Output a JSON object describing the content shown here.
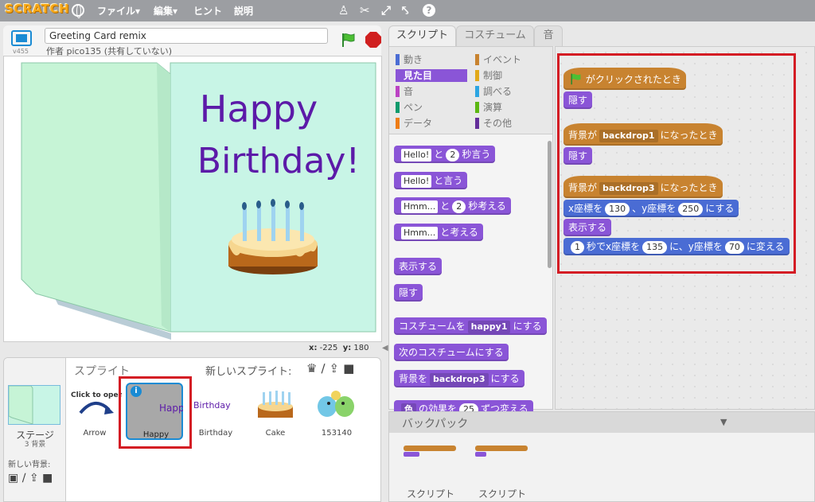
{
  "menubar": {
    "logo": "SCRATCH",
    "file": "ファイル▾",
    "edit": "編集▾",
    "tips": "ヒント",
    "about": "説明"
  },
  "stage_header": {
    "version": "v455",
    "title": "Greeting Card remix",
    "author": "作者 pico135 (共有していない)"
  },
  "stage": {
    "card_line1": "Happy",
    "card_line2": "Birthday!",
    "coord_x_label": "x:",
    "coord_x": "-225",
    "coord_y_label": "y:",
    "coord_y": "180"
  },
  "sprite_pane": {
    "sprites_label": "スプライト",
    "new_sprite_label": "新しいスプライト:",
    "stage_label": "ステージ",
    "stage_sub": "3 背景",
    "new_backdrop_label": "新しい背景:",
    "sprites": [
      {
        "name": "Arrow",
        "thumb_text": "Click to open"
      },
      {
        "name": "Happy",
        "thumb_text": "Happy"
      },
      {
        "name": "Birthday",
        "thumb_text": "Birthday"
      },
      {
        "name": "Cake"
      },
      {
        "name": "153140"
      }
    ],
    "info_badge": "i"
  },
  "tabs": {
    "scripts": "スクリプト",
    "costumes": "コスチューム",
    "sounds": "音"
  },
  "categories": {
    "motion": "動き",
    "looks": "見た目",
    "sound": "音",
    "pen": "ペン",
    "data": "データ",
    "events": "イベント",
    "control": "制御",
    "sensing": "調べる",
    "operators": "演算",
    "more": "その他"
  },
  "palette_blocks": {
    "say_for_text": "Hello!",
    "say_for_mid": "と",
    "say_for_num": "2",
    "say_for_end": "秒言う",
    "say_text": "Hello!",
    "say_end": "と言う",
    "think_for_text": "Hmm...",
    "think_for_mid": "と",
    "think_for_num": "2",
    "think_for_end": "秒考える",
    "think_text": "Hmm...",
    "think_end": "と考える",
    "show": "表示する",
    "hide": "隠す",
    "switch_costume_start": "コスチュームを",
    "switch_costume_value": "happy1",
    "switch_costume_end": "にする",
    "next_costume": "次のコスチュームにする",
    "switch_backdrop_start": "背景を",
    "switch_backdrop_value": "backdrop3",
    "switch_backdrop_end": "にする",
    "partial_start": "色",
    "partial_mid": "の効果を",
    "partial_num": "25",
    "partial_end": "ずつ変える"
  },
  "script_blocks": {
    "flag_hat": "がクリックされたとき",
    "hide1": "隠す",
    "backdrop_hat1_start": "背景が",
    "backdrop_hat1_value": "backdrop1",
    "backdrop_hat1_end": "になったとき",
    "hide2": "隠す",
    "backdrop_hat3_start": "背景が",
    "backdrop_hat3_value": "backdrop3",
    "backdrop_hat3_end": "になったとき",
    "goto_x_label": "x座標を",
    "goto_x": "130",
    "goto_y_label": "、y座標を",
    "goto_y": "250",
    "goto_end": "にする",
    "show": "表示する",
    "glide_secs": "1",
    "glide_label": "秒でx座標を",
    "glide_x": "135",
    "glide_y_label": "に、y座標を",
    "glide_y": "70",
    "glide_end": "に変える"
  },
  "backpack": {
    "title": "バックパック",
    "items": [
      {
        "label": "スクリプト"
      },
      {
        "label": "スクリプト"
      }
    ]
  },
  "colors": {
    "looks": "#8a55d7",
    "motion": "#4a6cd4",
    "events": "#c88330",
    "highlight": "#d41c24",
    "selected_sprite": "#1a8bd4"
  },
  "icons": {
    "globe": "globe-icon",
    "duplicate": "stamp-icon",
    "delete": "scissors-icon",
    "grow": "grow-icon",
    "shrink": "shrink-icon",
    "help": "help-icon"
  }
}
